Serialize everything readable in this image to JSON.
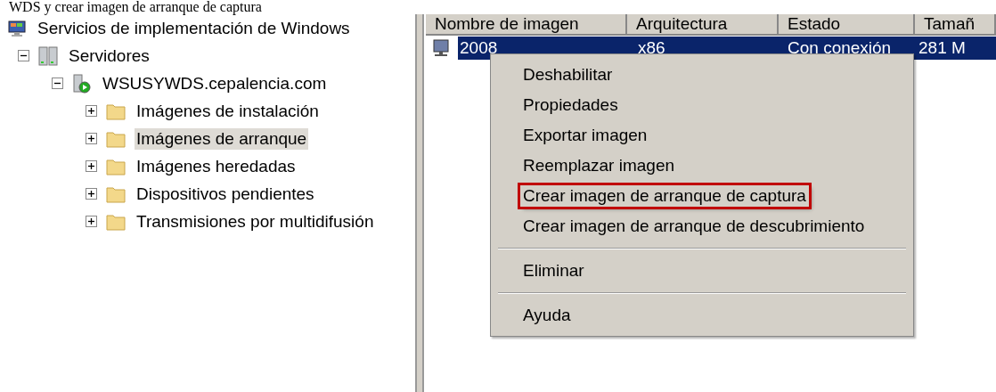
{
  "caption": "WDS y crear imagen de arranque de captura",
  "tree": [
    {
      "label": "Servicios de implementación de Windows",
      "kind": "root",
      "selected": false,
      "children": [
        {
          "label": "Servidores",
          "kind": "servers",
          "expanded": true,
          "selected": false,
          "children": [
            {
              "label": "WSUSYWDS.cepalencia.com",
              "kind": "server",
              "expanded": true,
              "selected": false,
              "children": [
                {
                  "label": "Imágenes de instalación",
                  "kind": "folder",
                  "expanded": false,
                  "selected": false
                },
                {
                  "label": "Imágenes de arranque",
                  "kind": "folder",
                  "expanded": false,
                  "selected": true
                },
                {
                  "label": "Imágenes heredadas",
                  "kind": "folder",
                  "expanded": false,
                  "selected": false
                },
                {
                  "label": "Dispositivos pendientes",
                  "kind": "folder",
                  "expanded": false,
                  "selected": false
                },
                {
                  "label": "Transmisiones por multidifusión",
                  "kind": "folder",
                  "expanded": false,
                  "selected": false
                }
              ]
            }
          ]
        }
      ]
    }
  ],
  "table": {
    "columns": [
      "Nombre de imagen",
      "Arquitectura",
      "Estado",
      "Tamañ"
    ],
    "rows": [
      {
        "cells": [
          "2008",
          "x86",
          "Con conexión",
          "281 M"
        ],
        "selected": true
      }
    ]
  },
  "context_menu": [
    {
      "kind": "item",
      "label": "Deshabilitar",
      "highlighted": false
    },
    {
      "kind": "item",
      "label": "Propiedades",
      "highlighted": false
    },
    {
      "kind": "item",
      "label": "Exportar imagen",
      "highlighted": false
    },
    {
      "kind": "item",
      "label": "Reemplazar imagen",
      "highlighted": false
    },
    {
      "kind": "item",
      "label": "Crear imagen de arranque de captura",
      "highlighted": true
    },
    {
      "kind": "item",
      "label": "Crear imagen de arranque de descubrimiento",
      "highlighted": false
    },
    {
      "kind": "separator"
    },
    {
      "kind": "item",
      "label": "Eliminar",
      "highlighted": false
    },
    {
      "kind": "separator"
    },
    {
      "kind": "item",
      "label": "Ayuda",
      "highlighted": false
    }
  ]
}
